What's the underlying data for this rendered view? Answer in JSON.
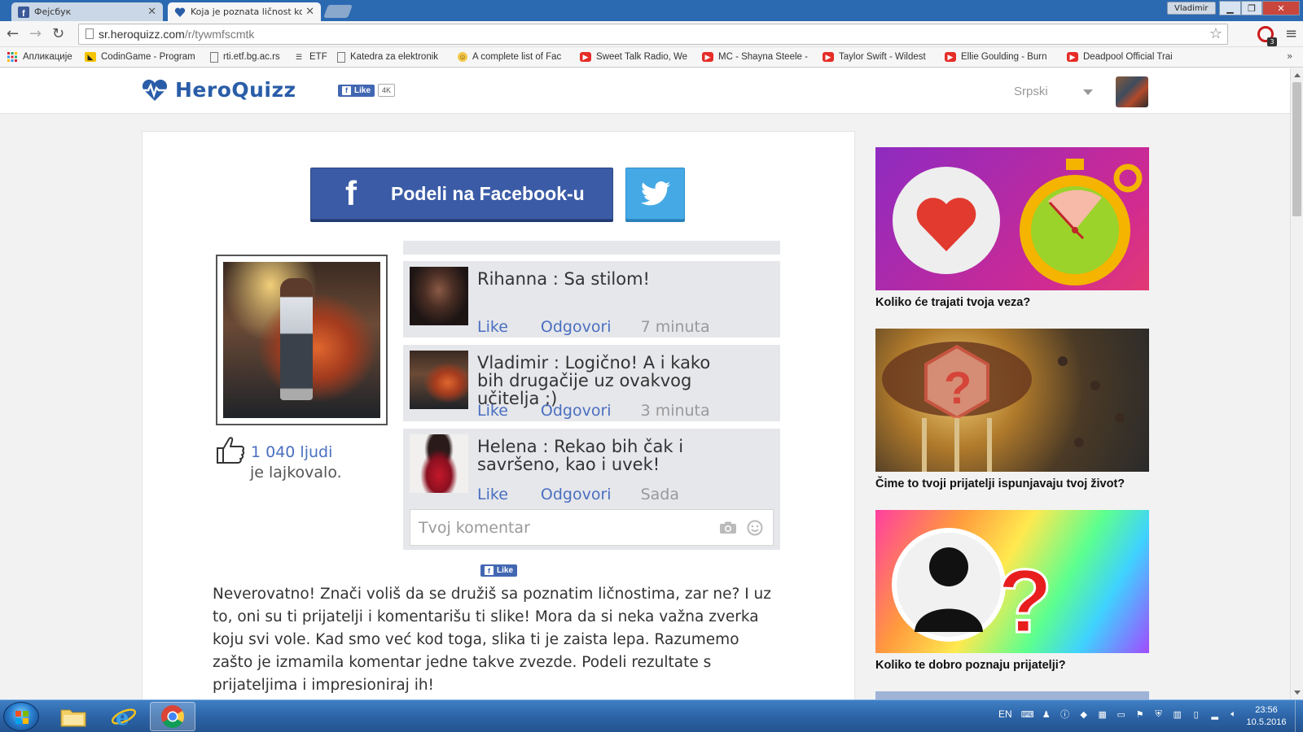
{
  "browser": {
    "tabs": [
      {
        "title": "Фејсбук",
        "active": false
      },
      {
        "title": "Koja je poznata ličnost ko",
        "active": true
      }
    ],
    "user": "Vladimir",
    "url_host": "sr.heroquizz.com",
    "url_path": "/r/tywmfscmtk",
    "extension_badge": "3",
    "bookmarks": [
      {
        "label": "Апликације",
        "icon": "apps-grid-icon"
      },
      {
        "label": "CodinGame - Program",
        "icon": "codingame-icon"
      },
      {
        "label": "rti.etf.bg.ac.rs",
        "icon": "page-icon"
      },
      {
        "label": "ETF",
        "icon": "stack-icon"
      },
      {
        "label": "Katedra za elektronik",
        "icon": "page-icon"
      },
      {
        "label": "A complete list of Fac",
        "icon": "emoji-icon"
      },
      {
        "label": "Sweet Talk Radio, We",
        "icon": "youtube-icon"
      },
      {
        "label": "MC - Shayna Steele -",
        "icon": "youtube-icon"
      },
      {
        "label": "Taylor Swift - Wildest",
        "icon": "youtube-icon"
      },
      {
        "label": "Ellie Goulding - Burn",
        "icon": "youtube-icon"
      },
      {
        "label": "Deadpool Official Trai",
        "icon": "youtube-icon"
      }
    ],
    "bookmarks_more": "»"
  },
  "site": {
    "logo": "HeroQuizz",
    "fb_like_label": "Like",
    "fb_like_count": "4K",
    "language": "Srpski"
  },
  "share": {
    "facebook_label": "Podeli na Facebook-u",
    "facebook_glyph": "f"
  },
  "profile": {
    "likes_count": "1 040 ljudi",
    "likes_text": "je lajkovalo."
  },
  "comments": [
    {
      "author_text": "Rihanna : Sa stilom!",
      "like": "Like",
      "reply": "Odgovori",
      "time": "7 minuta"
    },
    {
      "author_text": "Vladimir : Logično! A i kako bih drugačije uz ovakvog učitelja ;)",
      "like": "Like",
      "reply": "Odgovori",
      "time": "3 minuta"
    },
    {
      "author_text": "Helena : Rekao bih čak i savršeno, kao i uvek!",
      "like": "Like",
      "reply": "Odgovori",
      "time": "Sada"
    }
  ],
  "comment_input_placeholder": "Tvoj komentar",
  "page_like_label": "Like",
  "result_text": "Neverovatno! Znači voliš da se družiš sa poznatim ličnostima, zar ne? I uz to, oni su ti prijatelji i komentarišu ti slike! Mora da si neka važna zverka koju svi vole. Kad smo već kod toga, slika ti je zaista lepa. Razumemo zašto je izmamila komentar jedne takve zvezde. Podeli rezultate s prijateljima i impresioniraj ih!",
  "sidebar": [
    {
      "title": "Koliko će trajati tvoja veza?"
    },
    {
      "title": "Čime to tvoji prijatelji ispunjavaju tvoj život?"
    },
    {
      "title": "Koliko te dobro poznaju prijatelji?"
    }
  ],
  "taskbar": {
    "language": "EN",
    "time": "23:56",
    "date": "10.5.2016"
  },
  "colors": {
    "facebook_blue": "#3b5ba6",
    "twitter_blue": "#45a9e6",
    "link_blue": "#4a6fc0",
    "brand_blue": "#2a5da8"
  }
}
